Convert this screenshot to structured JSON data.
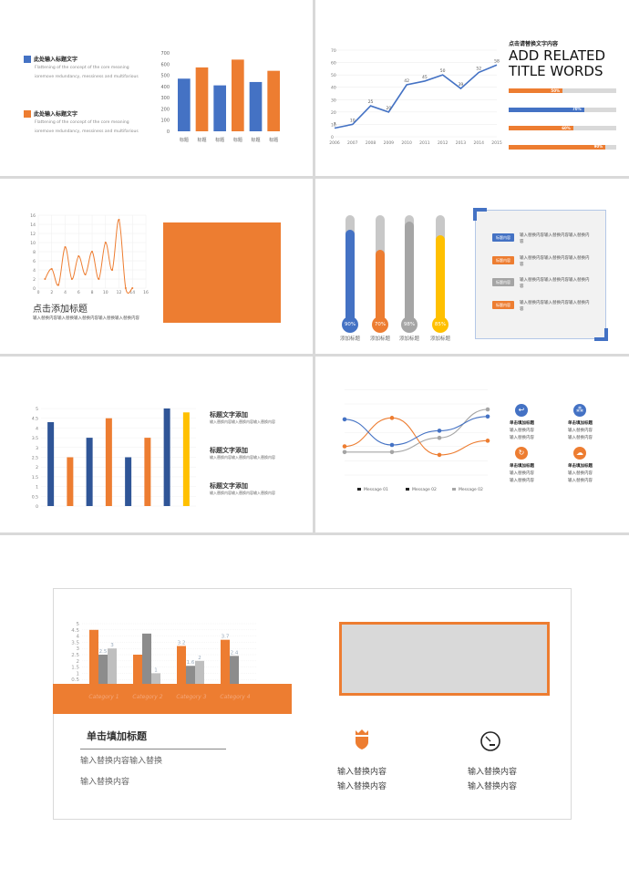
{
  "colors": {
    "blue": "#4472c4",
    "orange": "#ed7d31",
    "gray": "#a5a5a5",
    "yellow": "#ffc000",
    "darkblue": "#2f5597"
  },
  "slide1": {
    "items": [
      {
        "title": "此处输入标题文字",
        "desc": "Flattening of the concept of the core meaning ioremove redundancy, messiness and multifarious",
        "color": "#4472c4"
      },
      {
        "title": "此处输入标题文字",
        "desc": "Flattening of the concept of the core meaning ioremove redundancy, messiness and multifarious",
        "color": "#ed7d31"
      }
    ],
    "chart": {
      "type": "bar",
      "categories": [
        "标题",
        "标题",
        "标题",
        "标题",
        "标题",
        "标题"
      ],
      "values": [
        470,
        570,
        410,
        640,
        440,
        540
      ],
      "colors": [
        "#4472c4",
        "#ed7d31",
        "#4472c4",
        "#ed7d31",
        "#4472c4",
        "#ed7d31"
      ],
      "ylim": [
        0,
        700
      ],
      "yticks": [
        0,
        100,
        200,
        300,
        400,
        500,
        600,
        700
      ]
    }
  },
  "slide2": {
    "chart": {
      "type": "line",
      "x": [
        "2006",
        "2007",
        "2008",
        "2009",
        "2010",
        "2011",
        "2012",
        "2013",
        "2014",
        "2015"
      ],
      "values": [
        7,
        10,
        25,
        20,
        42,
        45,
        50,
        39,
        52,
        58
      ],
      "ylim": [
        0,
        70
      ],
      "yticks": [
        0,
        10,
        20,
        30,
        40,
        50,
        60,
        70
      ],
      "color": "#4472c4"
    },
    "subtitle": "点击请替换文字内容",
    "title_line1": "ADD RELATED",
    "title_line2": "TITLE WORDS",
    "progress": [
      {
        "label": "50%",
        "value": 50,
        "color": "#ed7d31"
      },
      {
        "label": "70%",
        "value": 70,
        "color": "#4472c4"
      },
      {
        "label": "60%",
        "value": 60,
        "color": "#ed7d31"
      },
      {
        "label": "90%",
        "value": 90,
        "color": "#ed7d31"
      }
    ]
  },
  "slide3": {
    "chart": {
      "type": "line",
      "points": [
        [
          1,
          2
        ],
        [
          2,
          4.2
        ],
        [
          3,
          0.7
        ],
        [
          4,
          9
        ],
        [
          5,
          2
        ],
        [
          6,
          7
        ],
        [
          7,
          3
        ],
        [
          8,
          8
        ],
        [
          9,
          2
        ],
        [
          10,
          10
        ],
        [
          11,
          4
        ],
        [
          12,
          15
        ],
        [
          13,
          0
        ],
        [
          14,
          0
        ]
      ],
      "xlim": [
        0,
        16
      ],
      "ylim": [
        0,
        16
      ],
      "xticks": [
        0,
        2,
        4,
        6,
        8,
        10,
        12,
        14,
        16
      ],
      "yticks": [
        0,
        2,
        4,
        6,
        8,
        10,
        12,
        14,
        16
      ],
      "color": "#ed7d31"
    },
    "title": "点击添加标题",
    "desc": "输入替换内容输入替换输入替换内容输入替换输入替换内容"
  },
  "slide4": {
    "thermometers": [
      {
        "value": 90,
        "label": "90%",
        "caption": "添加标题",
        "color": "#4472c4"
      },
      {
        "value": 70,
        "label": "70%",
        "caption": "添加标题",
        "color": "#ed7d31"
      },
      {
        "value": 98,
        "label": "98%",
        "caption": "添加标题",
        "color": "#a5a5a5"
      },
      {
        "value": 85,
        "label": "85%",
        "caption": "添加标题",
        "color": "#ffc000"
      }
    ],
    "list": [
      {
        "tag": "标题内容",
        "text": "输入替换内容输入替换内容输入替换内容",
        "color": "#4472c4"
      },
      {
        "tag": "标题内容",
        "text": "输入替换内容输入替换内容输入替换内容",
        "color": "#ed7d31"
      },
      {
        "tag": "标题内容",
        "text": "输入替换内容输入替换内容输入替换内容",
        "color": "#a5a5a5"
      },
      {
        "tag": "标题内容",
        "text": "输入替换内容输入替换内容输入替换内容",
        "color": "#ed7d31"
      }
    ]
  },
  "slide5": {
    "chart": {
      "type": "bar",
      "values": [
        4.3,
        2.5,
        3.5,
        4.5,
        2.5,
        3.5,
        5,
        4.8
      ],
      "colors": [
        "#2f5597",
        "#ed7d31",
        "#2f5597",
        "#ed7d31",
        "#2f5597",
        "#ed7d31",
        "#2f5597",
        "#ffc000"
      ],
      "ylim": [
        0,
        5
      ],
      "yticks": [
        "0",
        "0.5",
        "1",
        "1.5",
        "2",
        "2.5",
        "3",
        "3.5",
        "4",
        "4.5",
        "5"
      ]
    },
    "items": [
      {
        "title": "标题文字添加",
        "desc": "输入替换内容输入替换内容输入替换内容"
      },
      {
        "title": "标题文字添加",
        "desc": "输入替换内容输入替换内容输入替换内容"
      },
      {
        "title": "标题文字添加",
        "desc": "输入替换内容输入替换内容输入替换内容"
      }
    ]
  },
  "slide6": {
    "chart": {
      "type": "line",
      "series": [
        {
          "name": "Message 01",
          "values": [
            4.3,
            2.5,
            3.5,
            4.5
          ],
          "color": "#4472c4"
        },
        {
          "name": "Message 02",
          "values": [
            2.4,
            4.4,
            1.8,
            2.8
          ],
          "color": "#ed7d31"
        },
        {
          "name": "Message 02",
          "values": [
            2,
            2,
            3,
            5
          ],
          "color": "#a5a5a5"
        }
      ],
      "legend": "bottom"
    },
    "features": [
      {
        "icon": "return-icon",
        "title": "单击填加标题",
        "l1": "输入替换内容",
        "l2": "输入替换内容",
        "color": "#4472c4"
      },
      {
        "icon": "network-icon",
        "title": "单击填加标题",
        "l1": "输入替换内容",
        "l2": "输入替换内容",
        "color": "#4472c4"
      },
      {
        "icon": "refresh-icon",
        "title": "单击填加标题",
        "l1": "输入替换内容",
        "l2": "输入替换内容",
        "color": "#ed7d31"
      },
      {
        "icon": "cloud-icon",
        "title": "单击填加标题",
        "l1": "输入替换内容",
        "l2": "输入替换内容",
        "color": "#ed7d31"
      }
    ]
  },
  "slide7": {
    "chart": {
      "type": "bar",
      "categories": [
        "Category 1",
        "Category 2",
        "Category 3",
        "Category 4"
      ],
      "series": [
        {
          "values": [
            4.5,
            2.5,
            3.2,
            3.7
          ],
          "labels": [
            "",
            "",
            "3.2",
            "3.7"
          ],
          "color": "#ed7d31"
        },
        {
          "values": [
            2.5,
            4.2,
            1.6,
            2.4
          ],
          "labels": [
            "2.5",
            "",
            "1.6",
            "2.4"
          ],
          "color": "#8c8c8c"
        },
        {
          "values": [
            3,
            1,
            2,
            null
          ],
          "labels": [
            "3",
            "1",
            "2",
            ""
          ],
          "color": "#bfbfbf"
        }
      ],
      "ylim": [
        0,
        5
      ],
      "yticks": [
        "0",
        "0.5",
        "1",
        "1.5",
        "2",
        "2.5",
        "3",
        "3.5",
        "4",
        "4.5",
        "5"
      ]
    },
    "title": "单击填加标题",
    "line1": "输入替换内容输入替换",
    "line2": "输入替换内容",
    "features": [
      {
        "icon": "crown-shield-icon",
        "l1": "输入替换内容",
        "l2": "输入替换内容"
      },
      {
        "icon": "speedometer-icon",
        "l1": "输入替换内容",
        "l2": "输入替换内容"
      }
    ]
  }
}
